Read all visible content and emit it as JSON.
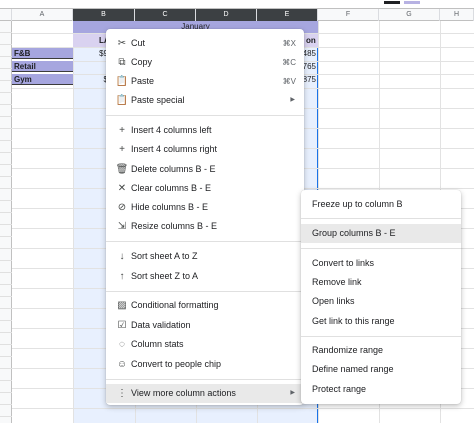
{
  "sheet": {
    "columns": [
      "A",
      "B",
      "C",
      "D",
      "E",
      "F",
      "G",
      "H"
    ],
    "header_row": {
      "title": "January",
      "partial_labels": [
        "LA",
        "on"
      ]
    },
    "rows": [
      {
        "label": "F&B",
        "b_value": "$9",
        "e_value": "485"
      },
      {
        "label": "Retail",
        "b_value": "",
        "e_value": "765"
      },
      {
        "label": "Gym",
        "b_value": "$",
        "e_value": "875"
      }
    ],
    "colors": {
      "header_band": "#a6a6df",
      "selection": "#e8f0fe",
      "selection_border": "#1a73e8",
      "selected_col_header": "#3c4043"
    }
  },
  "context_menu": {
    "items": [
      {
        "icon": "scissors-icon",
        "glyph": "✂",
        "label": "Cut",
        "shortcut": "⌘X"
      },
      {
        "icon": "copy-icon",
        "glyph": "⧉",
        "label": "Copy",
        "shortcut": "⌘C"
      },
      {
        "icon": "clipboard-icon",
        "glyph": "📋",
        "label": "Paste",
        "shortcut": "⌘V"
      },
      {
        "icon": "clipboard-icon",
        "glyph": "📋",
        "label": "Paste special",
        "submenu": true
      },
      {
        "icon": "plus-icon",
        "glyph": "+",
        "label": "Insert 4 columns left"
      },
      {
        "icon": "plus-icon",
        "glyph": "+",
        "label": "Insert 4 columns right"
      },
      {
        "icon": "trash-icon",
        "glyph": "🗑",
        "label": "Delete columns B - E"
      },
      {
        "icon": "close-icon",
        "glyph": "✕",
        "label": "Clear columns B - E"
      },
      {
        "icon": "eye-off-icon",
        "glyph": "⊘",
        "label": "Hide columns B - E"
      },
      {
        "icon": "resize-icon",
        "glyph": "⇲",
        "label": "Resize columns B - E"
      },
      {
        "icon": "sort-az-icon",
        "glyph": "↓",
        "label": "Sort sheet A to Z"
      },
      {
        "icon": "sort-za-icon",
        "glyph": "↑",
        "label": "Sort sheet Z to A"
      },
      {
        "icon": "conditional-formatting-icon",
        "glyph": "▨",
        "label": "Conditional formatting"
      },
      {
        "icon": "data-validation-icon",
        "glyph": "☑",
        "label": "Data validation"
      },
      {
        "icon": "lightbulb-icon",
        "glyph": "◌",
        "label": "Column stats"
      },
      {
        "icon": "people-chip-icon",
        "glyph": "☺",
        "label": "Convert to people chip"
      },
      {
        "icon": "more-vert-icon",
        "glyph": "⋮",
        "label": "View more column actions",
        "submenu": true
      }
    ]
  },
  "submenu": {
    "items": [
      {
        "label": "Freeze up to column B"
      },
      {
        "label": "Group columns B - E"
      },
      {
        "label": "Convert to links"
      },
      {
        "label": "Remove link"
      },
      {
        "label": "Open links"
      },
      {
        "label": "Get link to this range"
      },
      {
        "label": "Randomize range"
      },
      {
        "label": "Define named range"
      },
      {
        "label": "Protect range"
      }
    ]
  }
}
